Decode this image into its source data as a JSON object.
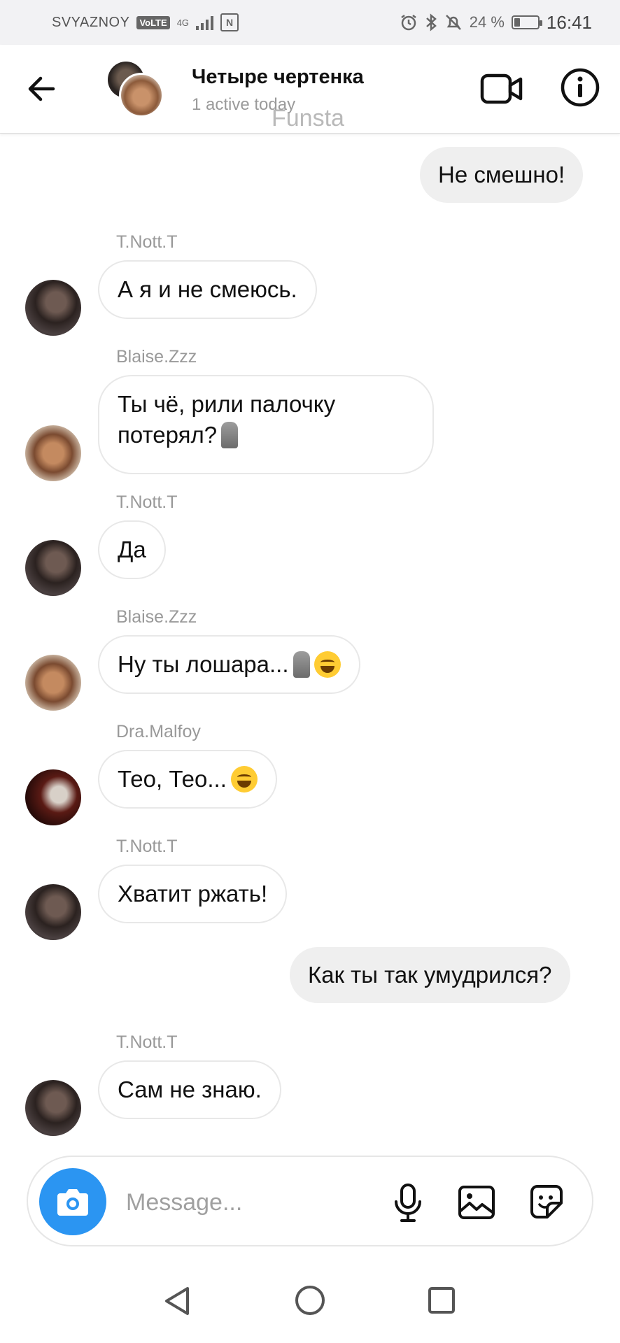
{
  "status_bar": {
    "carrier": "SVYAZNOY",
    "volte": "VoLTE",
    "network": "4G",
    "nfc": "N",
    "battery_text": "24 %",
    "battery_level": 0.24,
    "time": "16:41"
  },
  "header": {
    "title": "Четыре чертенка",
    "subtitle": "1 active today",
    "watermark": "Funsta"
  },
  "messages": [
    {
      "direction": "out",
      "text": "Не смешно!"
    },
    {
      "direction": "in",
      "sender": "T.Nott.T",
      "text": "А я и не смеюсь."
    },
    {
      "direction": "in",
      "sender": "Blaise.Zzz",
      "text_line1": "Ты чё, рили палочку",
      "text_line2": "потерял?",
      "emoji": [
        "moai"
      ]
    },
    {
      "direction": "in",
      "sender": "T.Nott.T",
      "text": "Да"
    },
    {
      "direction": "in",
      "sender": "Blaise.Zzz",
      "text": "Ну ты лошара...",
      "emoji": [
        "moai",
        "laughing-with-tears"
      ]
    },
    {
      "direction": "in",
      "sender": "Dra.Malfoy",
      "text": "Тео, Тео...",
      "emoji": [
        "laughing-with-tears"
      ]
    },
    {
      "direction": "in",
      "sender": "T.Nott.T",
      "text": "Хватит ржать!"
    },
    {
      "direction": "out",
      "text": "Как ты так умудрился?"
    },
    {
      "direction": "in",
      "sender": "T.Nott.T",
      "text": "Сам не знаю."
    }
  ],
  "composer": {
    "placeholder": "Message..."
  },
  "colors": {
    "camera_button": "#2b95f2",
    "outgoing_bubble": "#efefef",
    "incoming_bubble_border": "#e8e8e8"
  }
}
